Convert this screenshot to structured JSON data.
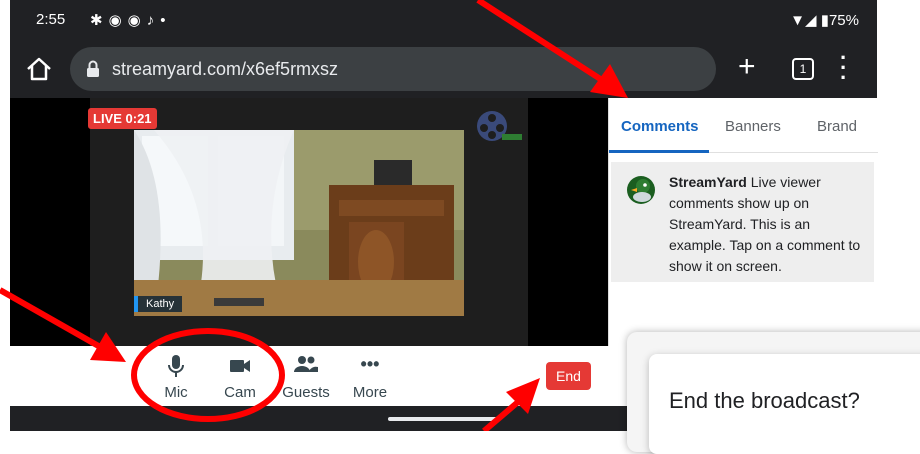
{
  "status_bar": {
    "time": "2:55",
    "battery": "75%",
    "notification_icons": [
      "slack-icon",
      "facebook-icon",
      "facebook-icon",
      "tiktok-icon",
      "dot-icon"
    ]
  },
  "browser": {
    "url": "streamyard.com/x6ef5rmxsz",
    "tab_count": "1"
  },
  "stage": {
    "live_label": "LIVE 0:21",
    "participant_name": "Kathy"
  },
  "panel": {
    "tabs": [
      "Comments",
      "Banners",
      "Brand"
    ],
    "active_tab": "Comments",
    "comment": {
      "author": "StreamYard",
      "text": "Live viewer comments show up on StreamYard. This is an example. Tap on a comment to show it on screen."
    }
  },
  "controls": {
    "mic": "Mic",
    "cam": "Cam",
    "guests": "Guests",
    "more": "More",
    "end": "End"
  },
  "dialog": {
    "title": "End the broadcast?"
  },
  "colors": {
    "accent": "#1565c0",
    "live_red": "#e53935",
    "annotation_red": "#ff0000"
  }
}
